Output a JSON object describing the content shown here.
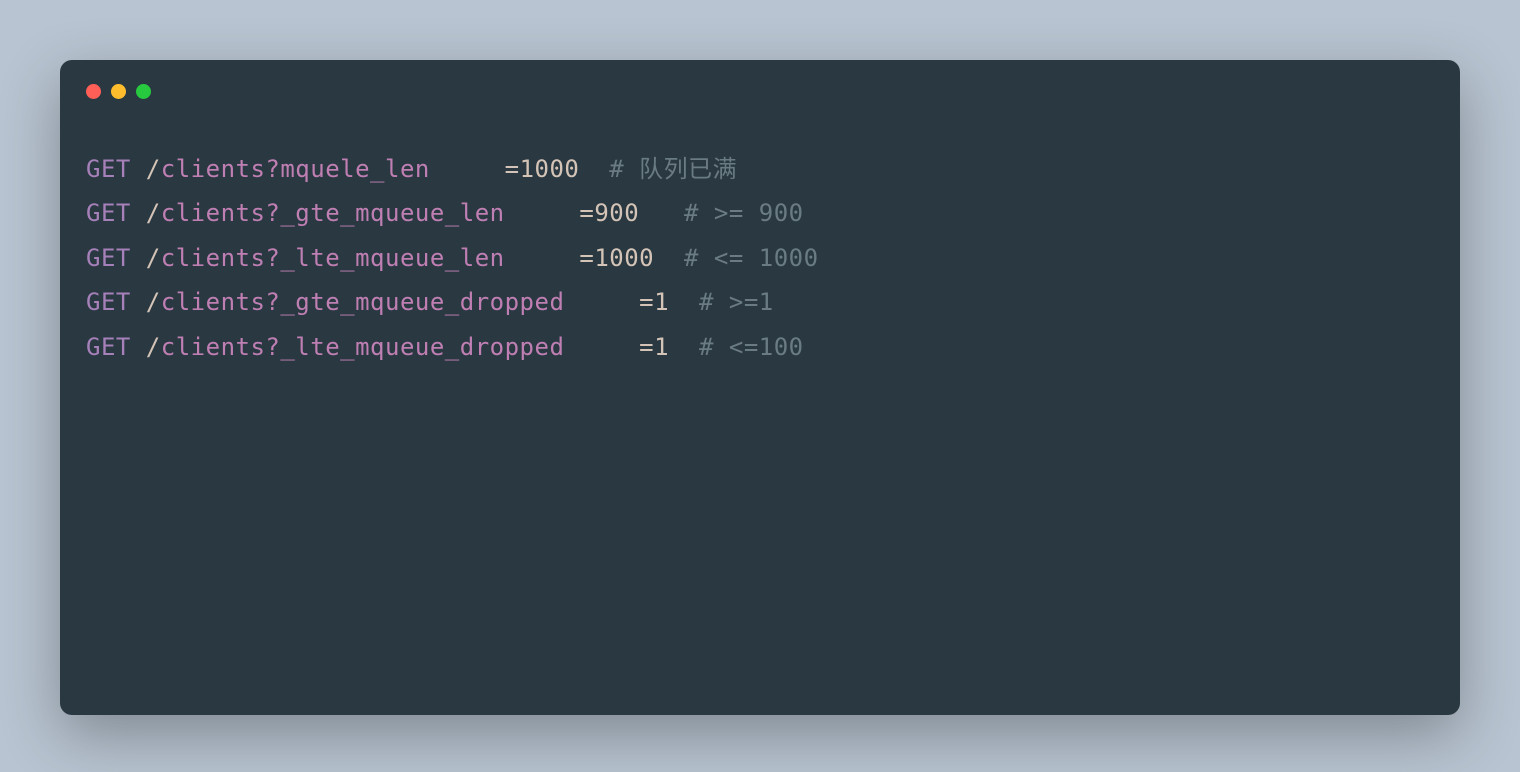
{
  "lines": [
    {
      "method": "GET",
      "slash": " /",
      "path": "clients?mquele_len",
      "pad": "     ",
      "eq": "=",
      "value": "1000",
      "gap": "  ",
      "comment": "# 队列已满"
    },
    {
      "method": "GET",
      "slash": " /",
      "path": "clients?_gte_mqueue_len",
      "pad": "     ",
      "eq": "=",
      "value": "900",
      "gap": "   ",
      "comment": "# >= 900"
    },
    {
      "method": "GET",
      "slash": " /",
      "path": "clients?_lte_mqueue_len",
      "pad": "     ",
      "eq": "=",
      "value": "1000",
      "gap": "  ",
      "comment": "# <= 1000"
    },
    {
      "method": "GET",
      "slash": " /",
      "path": "clients?_gte_mqueue_dropped",
      "pad": "     ",
      "eq": "=",
      "value": "1",
      "gap": "  ",
      "comment": "# >=1"
    },
    {
      "method": "GET",
      "slash": " /",
      "path": "clients?_lte_mqueue_dropped",
      "pad": "     ",
      "eq": "=",
      "value": "1",
      "gap": "  ",
      "comment": "# <=100"
    }
  ]
}
